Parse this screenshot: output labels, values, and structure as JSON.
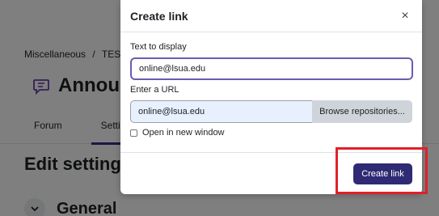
{
  "background": {
    "breadcrumb": [
      "Miscellaneous",
      "/",
      "TEST C"
    ],
    "page_title": "Announ",
    "tabs": [
      {
        "label": "Forum"
      },
      {
        "label": "Settings"
      }
    ],
    "section_heading": "Edit setting",
    "general_label": "General"
  },
  "modal": {
    "title": "Create link",
    "close_symbol": "×",
    "text_to_display_label": "Text to display",
    "text_to_display_value": "online@lsua.edu",
    "url_label": "Enter a URL",
    "url_value": "online@lsua.edu",
    "browse_label": "Browse repositories...",
    "new_window_label": "Open in new window",
    "new_window_checked": false,
    "create_button_label": "Create link"
  },
  "colors": {
    "primary_button": "#2f2a74",
    "focus_border": "#6a5cb0",
    "highlight": "#e0202a"
  }
}
